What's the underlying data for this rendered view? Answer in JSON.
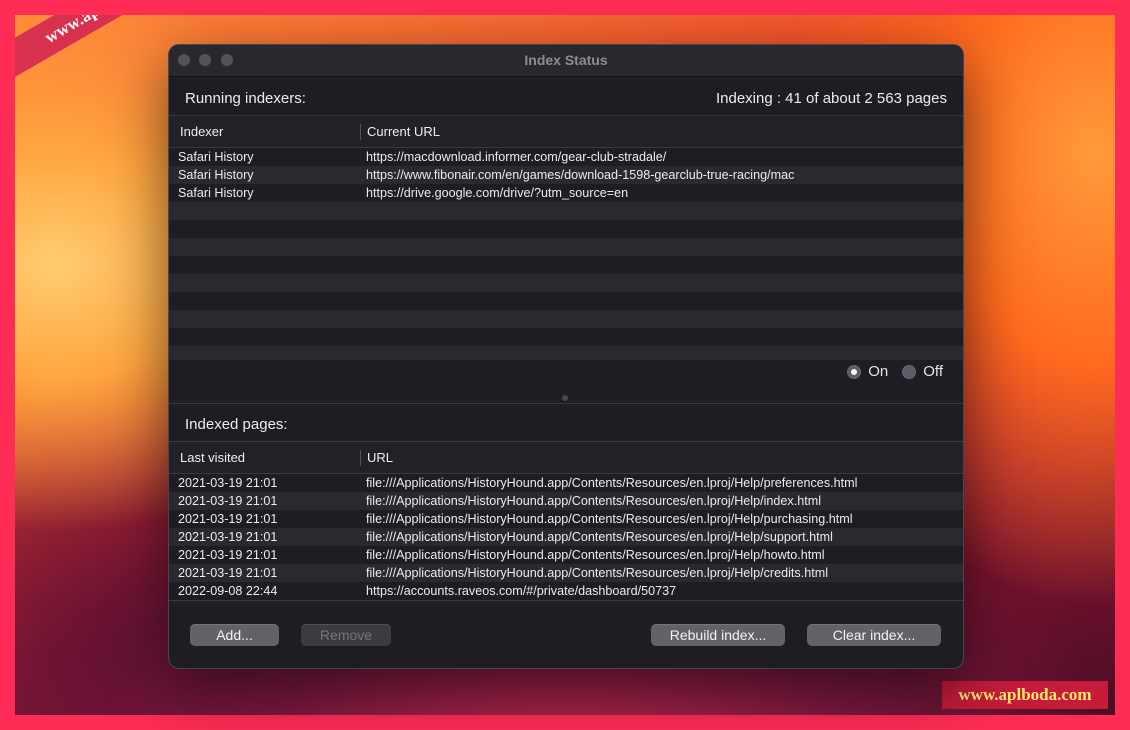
{
  "watermarks": {
    "corner": "www.aplboda.com",
    "bottom": "www.aplboda.com"
  },
  "window": {
    "title": "Index Status"
  },
  "running": {
    "label": "Running indexers:",
    "status": "Indexing : 41 of about 2 563 pages",
    "columns": [
      "Indexer",
      "Current URL"
    ],
    "rows": [
      {
        "indexer": "Safari History",
        "url": "https://macdownload.informer.com/gear-club-stradale/"
      },
      {
        "indexer": "Safari History",
        "url": "https://www.fibonair.com/en/games/download-1598-gearclub-true-racing/mac"
      },
      {
        "indexer": "Safari History",
        "url": "https://drive.google.com/drive/?utm_source=en"
      }
    ],
    "toggle": {
      "on_label": "On",
      "off_label": "Off",
      "selected": "On"
    }
  },
  "indexed": {
    "label": "Indexed pages:",
    "columns": [
      "Last visited",
      "URL"
    ],
    "rows": [
      {
        "date": "2021-03-19 21:01",
        "url": "file:///Applications/HistoryHound.app/Contents/Resources/en.lproj/Help/preferences.html"
      },
      {
        "date": "2021-03-19 21:01",
        "url": "file:///Applications/HistoryHound.app/Contents/Resources/en.lproj/Help/index.html"
      },
      {
        "date": "2021-03-19 21:01",
        "url": "file:///Applications/HistoryHound.app/Contents/Resources/en.lproj/Help/purchasing.html"
      },
      {
        "date": "2021-03-19 21:01",
        "url": "file:///Applications/HistoryHound.app/Contents/Resources/en.lproj/Help/support.html"
      },
      {
        "date": "2021-03-19 21:01",
        "url": "file:///Applications/HistoryHound.app/Contents/Resources/en.lproj/Help/howto.html"
      },
      {
        "date": "2021-03-19 21:01",
        "url": "file:///Applications/HistoryHound.app/Contents/Resources/en.lproj/Help/credits.html"
      },
      {
        "date": "2022-09-08 22:44",
        "url": "https://accounts.raveos.com/#/private/dashboard/50737"
      }
    ]
  },
  "buttons": {
    "add": "Add...",
    "remove": "Remove",
    "rebuild": "Rebuild index...",
    "clear": "Clear index..."
  }
}
